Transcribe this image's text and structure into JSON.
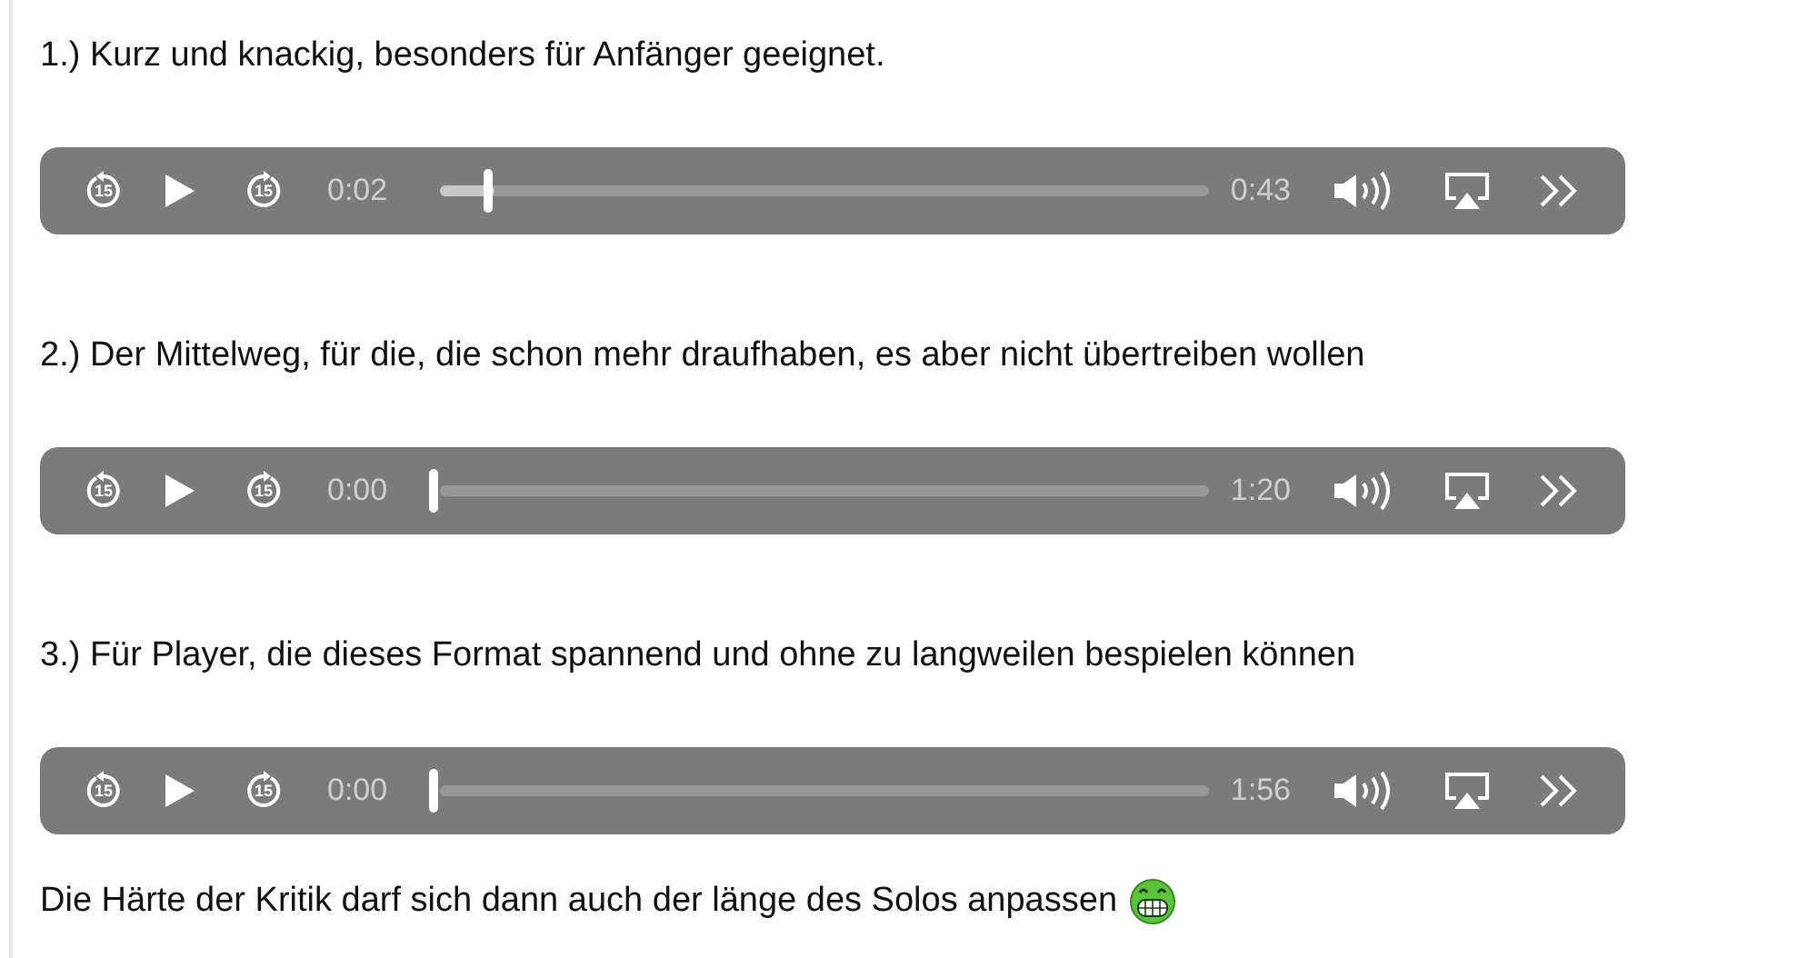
{
  "sections": [
    {
      "heading": "1.) Kurz und knackig, besonders für Anfänger geeignet.",
      "player": {
        "skip_back": "15",
        "skip_forward": "15",
        "current": "0:02",
        "duration": "0:43",
        "level": 0.07
      }
    },
    {
      "heading": "2.) Der Mittelweg, für die, die schon mehr draufhaben, es aber nicht übertreiben wollen",
      "player": {
        "skip_back": "15",
        "skip_forward": "15",
        "current": "0:00",
        "duration": "1:20",
        "level": 0
      }
    },
    {
      "heading": "3.) Für Player, die dieses Format spannend und ohne zu langweilen bespielen können",
      "player": {
        "skip_back": "15",
        "skip_forward": "15",
        "current": "0:00",
        "duration": "1:56",
        "level": 0
      }
    }
  ],
  "footer": "Die Härte der Kritik darf sich dann auch der länge des Solos anpassen"
}
